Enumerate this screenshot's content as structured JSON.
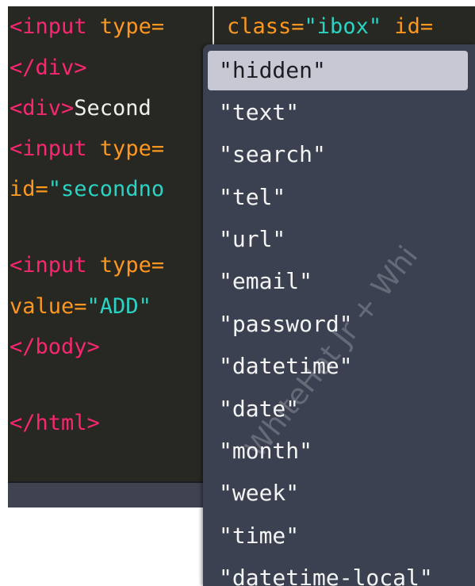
{
  "editor": {
    "lines": [
      {
        "tag": "<input",
        "attr": " type=",
        "str": "",
        "plain": ""
      },
      {
        "tag": "</div>",
        "attr": "",
        "str": "",
        "plain": ""
      },
      {
        "tag": "<div>",
        "attr": "",
        "str": "",
        "plain": "Second "
      },
      {
        "tag": "<input",
        "attr": " type=",
        "str": "",
        "plain": ""
      },
      {
        "tag": "",
        "attr": "id=",
        "str": "\"secondno",
        "plain": ""
      },
      {
        "tag": "<input",
        "attr": " type=",
        "str": "",
        "plain": ""
      },
      {
        "tag": "",
        "attr": "value=",
        "str": "\"ADD\"",
        "plain": ""
      },
      {
        "tag": "</body>",
        "attr": "",
        "str": "",
        "plain": ""
      },
      {
        "tag": "</html>",
        "attr": "",
        "str": "",
        "plain": ""
      }
    ],
    "top_right": {
      "attr1": "class=",
      "str1": "\"ibox\"",
      "attr2": " id="
    }
  },
  "dropdown": {
    "selected_index": 0,
    "items": [
      "\"hidden\"",
      "\"text\"",
      "\"search\"",
      "\"tel\"",
      "\"url\"",
      "\"email\"",
      "\"password\"",
      "\"datetime\"",
      "\"date\"",
      "\"month\"",
      "\"week\"",
      "\"time\"",
      "\"datetime-local\""
    ]
  },
  "watermark": "WhiteHat Jr + Whi",
  "colors": {
    "editor_bg": "#272822",
    "tag": "#f92672",
    "attribute": "#fd971f",
    "string": "#2ad3c4",
    "dropdown_bg": "#3b4150",
    "selected_bg": "#c7c8d3"
  }
}
